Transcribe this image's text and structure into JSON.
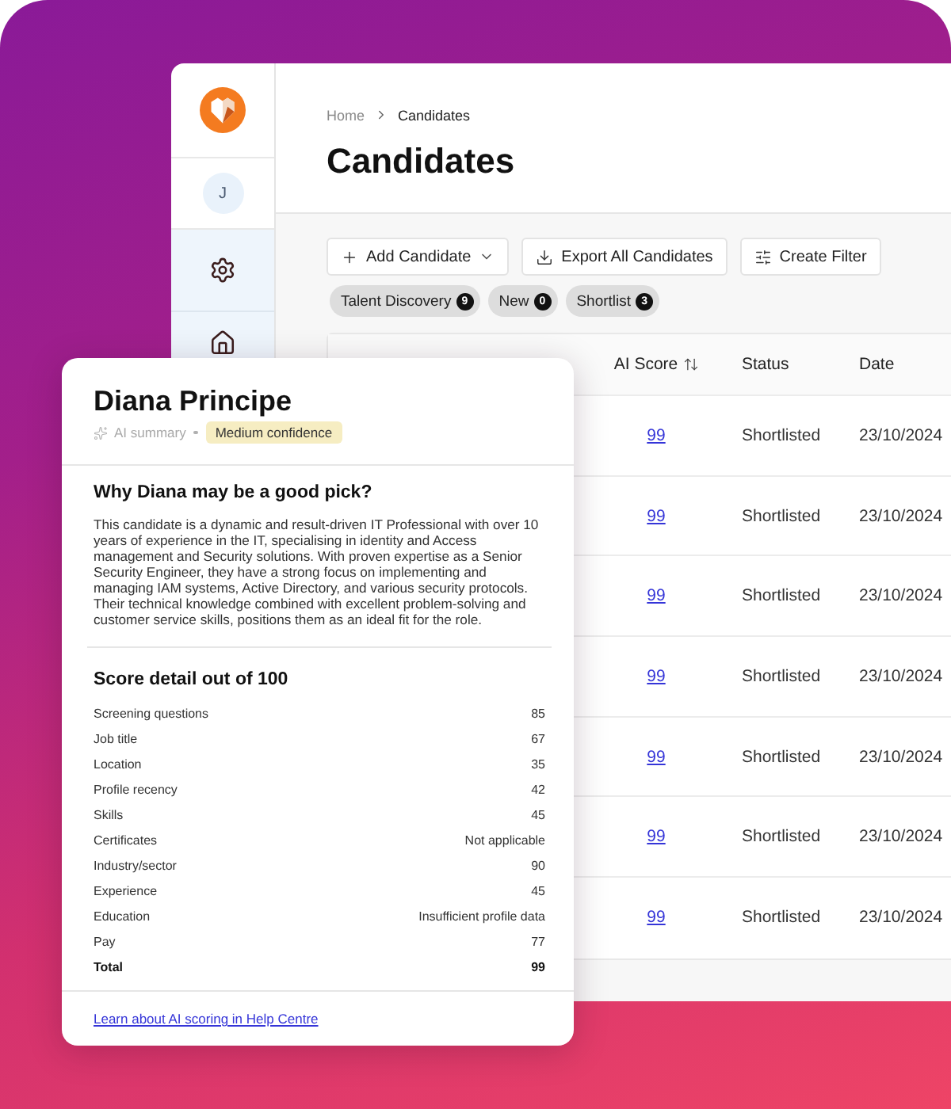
{
  "sidebar": {
    "avatar": "J"
  },
  "breadcrumb": [
    "Home",
    "Candidates"
  ],
  "title": "Candidates",
  "toolbar": [
    {
      "kind": "add",
      "label": "Add Candidate"
    },
    {
      "kind": "export",
      "label": "Export All Candidates"
    },
    {
      "kind": "filter",
      "label": "Create Filter"
    }
  ],
  "chips": [
    {
      "label": "Talent Discovery",
      "count": "9"
    },
    {
      "label": "New",
      "count": "0"
    },
    {
      "label": "Shortlist",
      "count": "3"
    }
  ],
  "table": {
    "columns": [
      {
        "label": "AI Score",
        "sortable": true
      },
      {
        "label": "Status",
        "sortable": false
      },
      {
        "label": "Date",
        "sortable": false
      }
    ],
    "rows": [
      {
        "score": "99",
        "status": "Shortlisted",
        "date": "23/10/2024"
      },
      {
        "score": "99",
        "status": "Shortlisted",
        "date": "23/10/2024"
      },
      {
        "score": "99",
        "status": "Shortlisted",
        "date": "23/10/2024"
      },
      {
        "score": "99",
        "status": "Shortlisted",
        "date": "23/10/2024"
      },
      {
        "score": "99",
        "status": "Shortlisted",
        "date": "23/10/2024"
      },
      {
        "score": "99",
        "status": "Shortlisted",
        "date": "23/10/2024"
      },
      {
        "score": "99",
        "status": "Shortlisted",
        "date": "23/10/2024"
      }
    ]
  },
  "card": {
    "name": "Diana Principe",
    "source": "AI summary",
    "confidence": "Medium confidence",
    "heading": "Why Diana may be a good pick?",
    "summary": "This candidate is a dynamic and result-driven IT Professional with over 10 years of experience in the IT, specialising in identity and Access management and Security solutions. With proven expertise as a Senior Security Engineer, they have a strong focus on implementing and managing IAM systems, Active Directory, and various security protocols. Their technical knowledge combined with excellent problem-solving and customer service skills, positions them as an ideal fit for the role.",
    "score_heading": "Score detail out of 100",
    "scores": [
      {
        "label": "Screening questions",
        "value": "85"
      },
      {
        "label": "Job title",
        "value": "67"
      },
      {
        "label": "Location",
        "value": "35"
      },
      {
        "label": "Profile recency",
        "value": "42"
      },
      {
        "label": "Skills",
        "value": "45"
      },
      {
        "label": "Certificates",
        "value": "Not applicable"
      },
      {
        "label": "Industry/sector",
        "value": "90"
      },
      {
        "label": "Experience",
        "value": "45"
      },
      {
        "label": "Education",
        "value": "Insufficient profile data"
      },
      {
        "label": "Pay",
        "value": "77"
      }
    ],
    "total": {
      "label": "Total",
      "value": "99"
    },
    "help_link": "Learn about AI scoring in Help Centre"
  }
}
